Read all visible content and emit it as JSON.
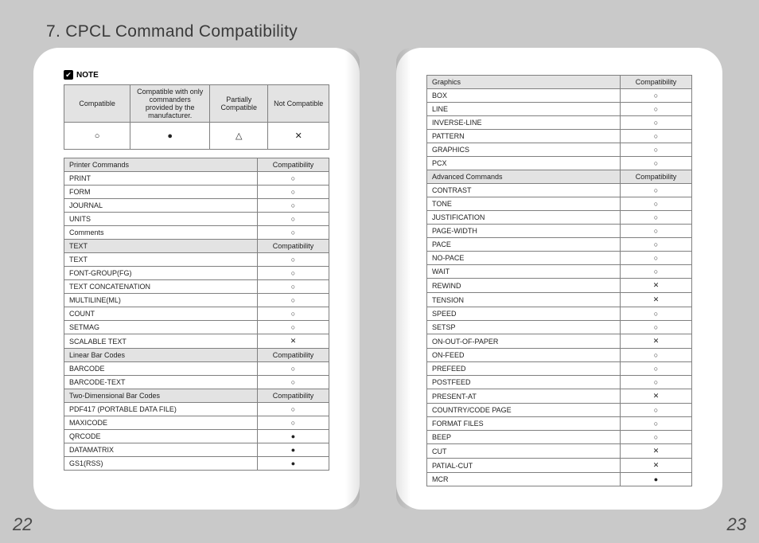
{
  "title": "7. CPCL Command Compatibility",
  "note_label": "NOTE",
  "page_numbers": {
    "left": "22",
    "right": "23"
  },
  "legend": {
    "headers": [
      "Compatible",
      "Compatible with only commanders provided by the manufacturer.",
      "Partially Compatible",
      "Not Compatible"
    ],
    "symbols": [
      "circ",
      "disc",
      "tri",
      "ex"
    ]
  },
  "compat_header_label": "Compatibility",
  "left_sections": [
    {
      "name": "Printer Commands",
      "rows": [
        {
          "cmd": "PRINT",
          "sym": "circ"
        },
        {
          "cmd": "FORM",
          "sym": "circ"
        },
        {
          "cmd": "JOURNAL",
          "sym": "circ"
        },
        {
          "cmd": "UNITS",
          "sym": "circ"
        },
        {
          "cmd": "Comments",
          "sym": "circ"
        }
      ]
    },
    {
      "name": "TEXT",
      "rows": [
        {
          "cmd": "TEXT",
          "sym": "circ"
        },
        {
          "cmd": "FONT-GROUP(FG)",
          "sym": "circ"
        },
        {
          "cmd": "TEXT CONCATENATION",
          "sym": "circ"
        },
        {
          "cmd": "MULTILINE(ML)",
          "sym": "circ"
        },
        {
          "cmd": "COUNT",
          "sym": "circ"
        },
        {
          "cmd": "SETMAG",
          "sym": "circ"
        },
        {
          "cmd": "SCALABLE TEXT",
          "sym": "ex"
        }
      ]
    },
    {
      "name": "Linear Bar Codes",
      "rows": [
        {
          "cmd": "BARCODE",
          "sym": "circ"
        },
        {
          "cmd": "BARCODE-TEXT",
          "sym": "circ"
        }
      ]
    },
    {
      "name": "Two-Dimensional Bar Codes",
      "rows": [
        {
          "cmd": "PDF417 (PORTABLE DATA FILE)",
          "sym": "circ"
        },
        {
          "cmd": "MAXICODE",
          "sym": "circ"
        },
        {
          "cmd": "QRCODE",
          "sym": "disc"
        },
        {
          "cmd": "DATAMATRIX",
          "sym": "disc"
        },
        {
          "cmd": "GS1(RSS)",
          "sym": "disc"
        }
      ]
    }
  ],
  "right_sections": [
    {
      "name": "Graphics",
      "rows": [
        {
          "cmd": "BOX",
          "sym": "circ"
        },
        {
          "cmd": "LINE",
          "sym": "circ"
        },
        {
          "cmd": "INVERSE-LINE",
          "sym": "circ"
        },
        {
          "cmd": "PATTERN",
          "sym": "circ"
        },
        {
          "cmd": "GRAPHICS",
          "sym": "circ"
        },
        {
          "cmd": "PCX",
          "sym": "circ"
        }
      ]
    },
    {
      "name": "Advanced Commands",
      "rows": [
        {
          "cmd": "CONTRAST",
          "sym": "circ"
        },
        {
          "cmd": "TONE",
          "sym": "circ"
        },
        {
          "cmd": "JUSTIFICATION",
          "sym": "circ"
        },
        {
          "cmd": "PAGE-WIDTH",
          "sym": "circ"
        },
        {
          "cmd": "PACE",
          "sym": "circ"
        },
        {
          "cmd": "NO-PACE",
          "sym": "circ"
        },
        {
          "cmd": "WAIT",
          "sym": "circ"
        },
        {
          "cmd": "REWIND",
          "sym": "ex"
        },
        {
          "cmd": "TENSION",
          "sym": "ex"
        },
        {
          "cmd": "SPEED",
          "sym": "circ"
        },
        {
          "cmd": "SETSP",
          "sym": "circ"
        },
        {
          "cmd": "ON-OUT-OF-PAPER",
          "sym": "ex"
        },
        {
          "cmd": "ON-FEED",
          "sym": "circ"
        },
        {
          "cmd": "PREFEED",
          "sym": "circ"
        },
        {
          "cmd": "POSTFEED",
          "sym": "circ"
        },
        {
          "cmd": "PRESENT-AT",
          "sym": "ex"
        },
        {
          "cmd": "COUNTRY/CODE PAGE",
          "sym": "circ"
        },
        {
          "cmd": "FORMAT FILES",
          "sym": "circ"
        },
        {
          "cmd": "BEEP",
          "sym": "circ"
        },
        {
          "cmd": "CUT",
          "sym": "ex"
        },
        {
          "cmd": "PATIAL-CUT",
          "sym": "ex"
        },
        {
          "cmd": "MCR",
          "sym": "disc"
        }
      ]
    }
  ]
}
